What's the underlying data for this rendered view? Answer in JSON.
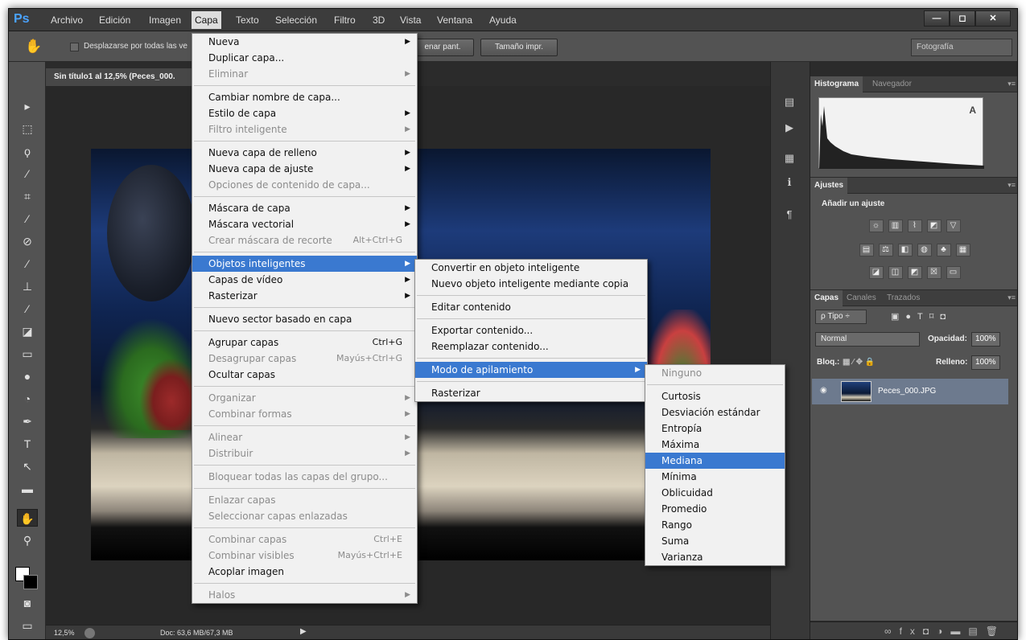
{
  "app": {
    "logo": "Ps"
  },
  "menubar": {
    "items": [
      "Archivo",
      "Edición",
      "Imagen",
      "Capa",
      "Texto",
      "Selección",
      "Filtro",
      "3D",
      "Vista",
      "Ventana",
      "Ayuda"
    ],
    "active": "Capa"
  },
  "window_buttons": {
    "minimize": "—",
    "maximize": "◻",
    "close": "✕"
  },
  "options_bar": {
    "checkbox_label": "Desplazarse por todas las ve",
    "btn_fill": "enar pant.",
    "btn_print": "Tamaño impr.",
    "workspace": "Fotografía"
  },
  "document": {
    "tab_title": "Sin título1 al 12,5% (Peces_000.",
    "zoom": "12,5%",
    "doc_size": "Doc: 63,6 MB/67,3 MB"
  },
  "capa_menu": [
    {
      "label": "Nueva",
      "arrow": true
    },
    {
      "label": "Duplicar capa..."
    },
    {
      "label": "Eliminar",
      "disabled": true,
      "arrow": true
    },
    {
      "sep": true
    },
    {
      "label": "Cambiar nombre de capa..."
    },
    {
      "label": "Estilo de capa",
      "arrow": true
    },
    {
      "label": "Filtro inteligente",
      "disabled": true,
      "arrow": true
    },
    {
      "sep": true
    },
    {
      "label": "Nueva capa de relleno",
      "arrow": true
    },
    {
      "label": "Nueva capa de ajuste",
      "arrow": true
    },
    {
      "label": "Opciones de contenido de capa...",
      "disabled": true
    },
    {
      "sep": true
    },
    {
      "label": "Máscara de capa",
      "arrow": true
    },
    {
      "label": "Máscara vectorial",
      "arrow": true
    },
    {
      "label": "Crear máscara de recorte",
      "disabled": true,
      "shortcut": "Alt+Ctrl+G"
    },
    {
      "sep": true
    },
    {
      "label": "Objetos inteligentes",
      "arrow": true,
      "highlight": true
    },
    {
      "label": "Capas de vídeo",
      "arrow": true
    },
    {
      "label": "Rasterizar",
      "arrow": true
    },
    {
      "sep": true
    },
    {
      "label": "Nuevo sector basado en capa"
    },
    {
      "sep": true
    },
    {
      "label": "Agrupar capas",
      "shortcut": "Ctrl+G"
    },
    {
      "label": "Desagrupar capas",
      "disabled": true,
      "shortcut": "Mayús+Ctrl+G"
    },
    {
      "label": "Ocultar capas"
    },
    {
      "sep": true
    },
    {
      "label": "Organizar",
      "disabled": true,
      "arrow": true
    },
    {
      "label": "Combinar formas",
      "disabled": true,
      "arrow": true
    },
    {
      "sep": true
    },
    {
      "label": "Alinear",
      "disabled": true,
      "arrow": true
    },
    {
      "label": "Distribuir",
      "disabled": true,
      "arrow": true
    },
    {
      "sep": true
    },
    {
      "label": "Bloquear todas las capas del grupo...",
      "disabled": true
    },
    {
      "sep": true
    },
    {
      "label": "Enlazar capas",
      "disabled": true
    },
    {
      "label": "Seleccionar capas enlazadas",
      "disabled": true
    },
    {
      "sep": true
    },
    {
      "label": "Combinar capas",
      "disabled": true,
      "shortcut": "Ctrl+E"
    },
    {
      "label": "Combinar visibles",
      "disabled": true,
      "shortcut": "Mayús+Ctrl+E"
    },
    {
      "label": "Acoplar imagen"
    },
    {
      "sep": true
    },
    {
      "label": "Halos",
      "disabled": true,
      "arrow": true
    }
  ],
  "objetos_menu": [
    {
      "label": "Convertir en objeto inteligente"
    },
    {
      "label": "Nuevo objeto inteligente mediante copia"
    },
    {
      "sep": true
    },
    {
      "label": "Editar contenido"
    },
    {
      "sep": true
    },
    {
      "label": "Exportar contenido..."
    },
    {
      "label": "Reemplazar contenido..."
    },
    {
      "sep": true
    },
    {
      "label": "Modo de apilamiento",
      "arrow": true,
      "highlight": true
    },
    {
      "sep": true
    },
    {
      "label": "Rasterizar"
    }
  ],
  "apilamiento_menu": [
    {
      "label": "Ninguno",
      "disabled": true
    },
    {
      "sep": true
    },
    {
      "label": "Curtosis"
    },
    {
      "label": "Desviación estándar"
    },
    {
      "label": "Entropía"
    },
    {
      "label": "Máxima"
    },
    {
      "label": "Mediana",
      "highlight": true
    },
    {
      "label": "Mínima"
    },
    {
      "label": "Oblicuidad"
    },
    {
      "label": "Promedio"
    },
    {
      "label": "Rango"
    },
    {
      "label": "Suma"
    },
    {
      "label": "Varianza"
    }
  ],
  "panels": {
    "histogram_tabs": [
      "Histograma",
      "Navegador"
    ],
    "histogram_warning": "A",
    "ajustes_tab": "Ajustes",
    "ajustes_title": "Añadir un ajuste",
    "layers_tabs": [
      "Capas",
      "Canales",
      "Trazados"
    ],
    "filter": "ρ Tipo ÷",
    "blend_mode": "Normal",
    "opacity_label": "Opacidad:",
    "opacity": "100%",
    "lock_label": "Bloq.:",
    "fill_label": "Relleno:",
    "fill": "100%",
    "layer_name": "Peces_000.JPG"
  },
  "colors": {
    "menu_highlight": "#3a79d0",
    "ui_dark": "#535353",
    "menu_bg": "#f1f1f1"
  }
}
